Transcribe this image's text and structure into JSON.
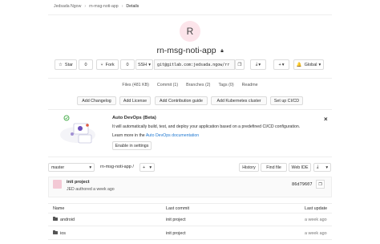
{
  "breadcrumb": {
    "owner": "Jedsada Ngow",
    "project": "rn-msg-noti-app",
    "current": "Details"
  },
  "project": {
    "avatar_letter": "R",
    "name": "rn-msg-noti-app",
    "visibility_icon": "lock-icon"
  },
  "actions": {
    "star_label": "Star",
    "star_count": "0",
    "fork_label": "Fork",
    "fork_count": "0",
    "clone_protocol": "SSH",
    "clone_url": "git@gitlab.com:jedsada.ngow/rr",
    "global_label": "Global"
  },
  "stats": {
    "files": "Files (481 KB)",
    "commits": "Commit (1)",
    "branches": "Branches (2)",
    "tags": "Tags (0)",
    "readme": "Readme"
  },
  "suggestions": [
    "Add Changelog",
    "Add License",
    "Add Contribution guide",
    "Add Kubernetes cluster",
    "Set up CI/CD"
  ],
  "autodevops": {
    "title": "Auto DevOps (Beta)",
    "description": "It will automatically build, test, and deploy your application based on a predefined CI/CD configuration.",
    "learn_prefix": "Learn more in the",
    "learn_link": "Auto DevOps documentation",
    "enable_button": "Enable in settings",
    "close": "×"
  },
  "repo_nav": {
    "branch": "master",
    "path": "rn-msg-noti-app",
    "path_sep": "/",
    "add": "+",
    "history": "History",
    "find_file": "Find file",
    "web_ide": "Web IDE"
  },
  "last_commit": {
    "title": "init project",
    "author_line": "JED authored a week ago",
    "sha": "86d79607"
  },
  "table": {
    "headers": {
      "name": "Name",
      "last_commit": "Last commit",
      "last_update": "Last update"
    },
    "rows": [
      {
        "name": "android",
        "commit": "init project",
        "updated": "a week ago"
      },
      {
        "name": "ios",
        "commit": "init project",
        "updated": "a week ago"
      }
    ]
  },
  "colors": {
    "link": "#1f78d1",
    "avatar_bg": "#fce4ea",
    "border": "#dcdcdc"
  }
}
